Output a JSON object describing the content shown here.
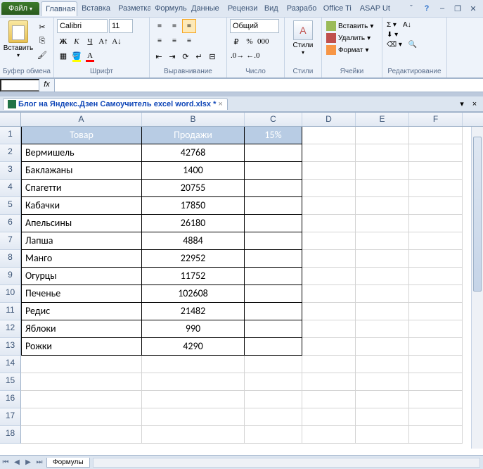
{
  "tabs": {
    "file": "Файл",
    "items": [
      "Главная",
      "Вставка",
      "Разметка",
      "Формулы",
      "Данные",
      "Рецензи",
      "Вид",
      "Разрабо",
      "Office Ti",
      "ASAP Ut"
    ],
    "active_index": 0
  },
  "ribbon": {
    "clipboard": {
      "paste": "Вставить",
      "label": "Буфер обмена"
    },
    "font": {
      "name": "Calibri",
      "size": "11",
      "label": "Шрифт"
    },
    "alignment": {
      "label": "Выравнивание"
    },
    "number": {
      "format": "Общий",
      "label": "Число"
    },
    "styles": {
      "btn": "Стили",
      "label": "Стили"
    },
    "cells": {
      "insert": "Вставить",
      "delete": "Удалить",
      "format": "Формат",
      "label": "Ячейки"
    },
    "editing": {
      "label": "Редактирование"
    }
  },
  "formula_bar": {
    "name_box": "",
    "fx": "fx",
    "formula": ""
  },
  "workbook_tab": "Блог на Яндекс.Дзен Самоучитель excel word.xlsx *",
  "columns": [
    "A",
    "B",
    "C",
    "D",
    "E",
    "F"
  ],
  "table": {
    "headers": [
      "Товар",
      "Продажи",
      "15%"
    ],
    "rows": [
      {
        "a": "Вермишель",
        "b": "42768",
        "c": ""
      },
      {
        "a": "Баклажаны",
        "b": "1400",
        "c": ""
      },
      {
        "a": "Спагетти",
        "b": "20755",
        "c": ""
      },
      {
        "a": "Кабачки",
        "b": "17850",
        "c": ""
      },
      {
        "a": "Апельсины",
        "b": "26180",
        "c": ""
      },
      {
        "a": "Лапша",
        "b": "4884",
        "c": ""
      },
      {
        "a": "Манго",
        "b": "22952",
        "c": ""
      },
      {
        "a": "Огурцы",
        "b": "11752",
        "c": ""
      },
      {
        "a": "Печенье",
        "b": "102608",
        "c": ""
      },
      {
        "a": "Редис",
        "b": "21482",
        "c": ""
      },
      {
        "a": "Яблоки",
        "b": "990",
        "c": ""
      },
      {
        "a": "Рожки",
        "b": "4290",
        "c": ""
      }
    ]
  },
  "sheet_tab": "Формулы",
  "row_count": 18
}
